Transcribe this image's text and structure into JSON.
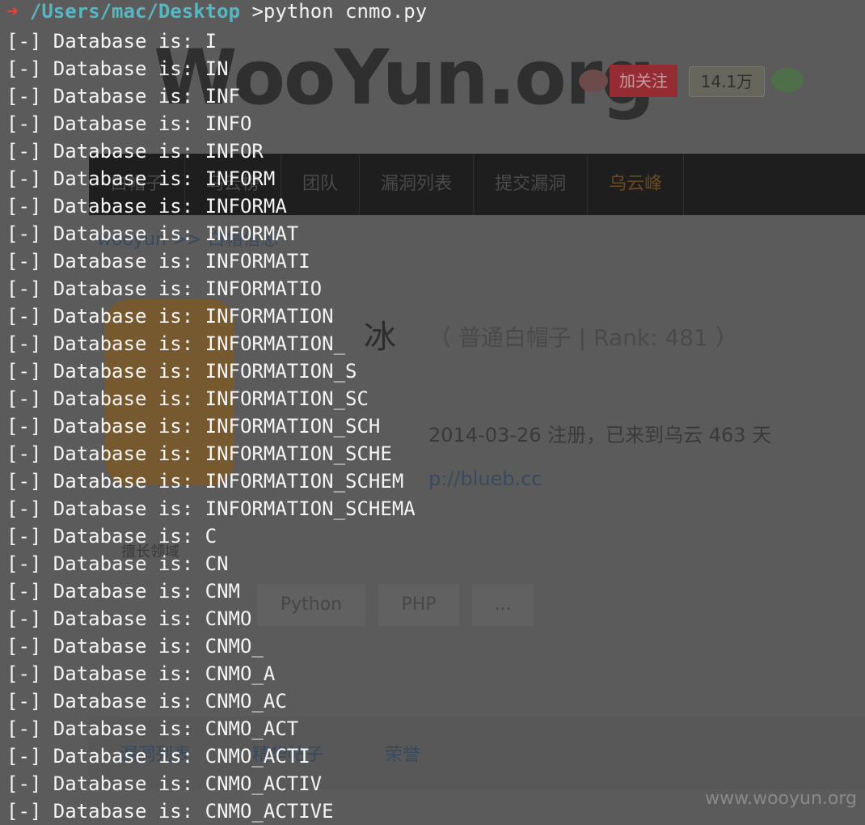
{
  "terminal": {
    "prompt": {
      "arrow": "➜",
      "path": "/Users/mac/Desktop",
      "command": ">python cnmo.py"
    },
    "lines": [
      "[-] Database is: I",
      "[-] Database is: IN",
      "[-] Database is: INF",
      "[-] Database is: INFO",
      "[-] Database is: INFOR",
      "[-] Database is: INFORM",
      "[-] Database is: INFORMA",
      "[-] Database is: INFORMAT",
      "[-] Database is: INFORMATI",
      "[-] Database is: INFORMATIO",
      "[-] Database is: INFORMATION",
      "[-] Database is: INFORMATION_",
      "[-] Database is: INFORMATION_S",
      "[-] Database is: INFORMATION_SC",
      "[-] Database is: INFORMATION_SCH",
      "[-] Database is: INFORMATION_SCHE",
      "[-] Database is: INFORMATION_SCHEM",
      "[-] Database is: INFORMATION_SCHEMA",
      "[-] Database is: C",
      "[-] Database is: CN",
      "[-] Database is: CNM",
      "[-] Database is: CNMO",
      "[-] Database is: CNMO_",
      "[-] Database is: CNMO_A",
      "[-] Database is: CNMO_AC",
      "[-] Database is: CNMO_ACT",
      "[-] Database is: CNMO_ACTI",
      "[-] Database is: CNMO_ACTIV",
      "[-] Database is: CNMO_ACTIVE"
    ]
  },
  "background_page": {
    "logo": "WooYun.org",
    "follow_button": "加关注",
    "follower_count": "14.1万",
    "nav_items": [
      "白帽子",
      "乌云榜",
      "团队",
      "漏洞列表",
      "提交漏洞",
      "乌云峰"
    ],
    "breadcrumb": "wooyun >> 白帽信息",
    "username": "冰",
    "rank_text": "（ 普通白帽子 | Rank: 481 ）",
    "register_text": "2014-03-26 注册，已来到乌云 463 天",
    "homepage_link": "p://blueb.cc",
    "section_label": "擅长领域",
    "tags": [
      "Python",
      "PHP",
      "..."
    ],
    "tabs": [
      "漏洞列表",
      "精华帖子",
      "荣誉"
    ]
  },
  "watermark": "www.wooyun.org",
  "colors": {
    "terminal_text": "#f4f4f4",
    "prompt_arrow": "#e0443a",
    "prompt_path": "#56b6c2",
    "background": "#5b5b5b"
  }
}
